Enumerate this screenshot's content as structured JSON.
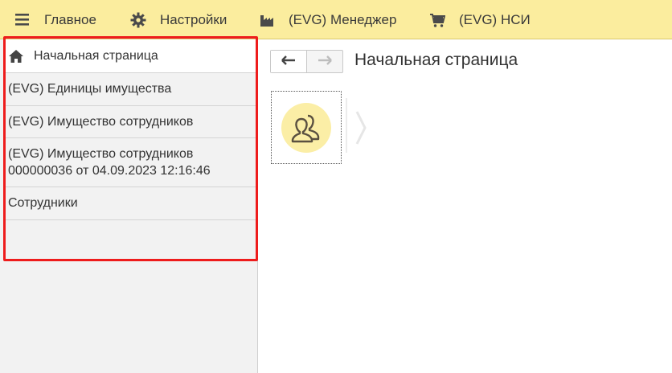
{
  "topbar": {
    "items": [
      {
        "label": "Главное",
        "icon": "hamburger-icon"
      },
      {
        "label": "Настройки",
        "icon": "gear-icon"
      },
      {
        "label": "(EVG) Менеджер",
        "icon": "factory-icon"
      },
      {
        "label": "(EVG) НСИ",
        "icon": "cart-icon"
      }
    ]
  },
  "sidebar": {
    "home_label": "Начальная страница",
    "items": [
      {
        "label": "(EVG) Единицы имущества"
      },
      {
        "label": "(EVG) Имущество сотрудников"
      },
      {
        "label_line1": "(EVG) Имущество сотрудников",
        "label_line2": "000000036 от 04.09.2023 12:16:46"
      },
      {
        "label": "Сотрудники"
      }
    ]
  },
  "main": {
    "title": "Начальная страница",
    "tile_icon": "employees-icon"
  },
  "colors": {
    "topbar_bg": "#fbed9e",
    "highlight_frame": "#ee1c1c",
    "tile_circle": "#fbeea6"
  }
}
